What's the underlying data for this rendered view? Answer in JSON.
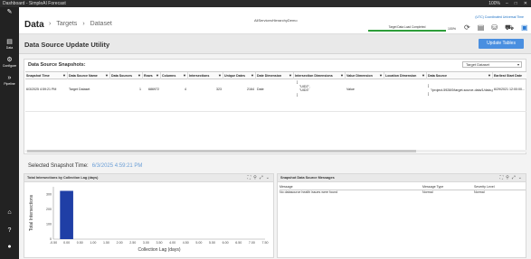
{
  "titlebar": {
    "title": "Dashboard - SimpleAI Forecast",
    "zoom": "100%"
  },
  "rail": [
    {
      "icon": "✎",
      "label": ""
    },
    {
      "icon": "▤",
      "label": "Data"
    },
    {
      "icon": "⚙",
      "label": "Configure"
    },
    {
      "icon": "»",
      "label": "Pipeline"
    },
    {
      "icon": "⌂",
      "label": ""
    },
    {
      "icon": "?",
      "label": ""
    },
    {
      "icon": "●",
      "label": ""
    }
  ],
  "header": {
    "title": "Data",
    "crumbs": [
      "Targets",
      "Dataset"
    ],
    "org": "AllServicesHierarchyDemo",
    "sysinfo": "(UTC) Coordinated Universal Time",
    "status_label": "Target Data Load Completed",
    "status_pct": "100%",
    "status_value": 100
  },
  "page": {
    "title": "Data Source Update Utility",
    "update_button": "Update Tables"
  },
  "snapshots": {
    "title": "Data Source Snapshots:",
    "dropdown": "Target Dataset",
    "columns": [
      "Snapshot Time",
      "Data Source Name",
      "Data Sources",
      "Rows",
      "Columns",
      "Intersections",
      "Unique Dates",
      "Date Dimension",
      "Intersection Dimensions",
      "Value Dimension",
      "Location Dimension",
      "Data Source",
      "Earliest Start Date"
    ],
    "row": {
      "snapshot_time": "6/3/2025 4:59:21 PM",
      "name": "Target Dataset",
      "sources": "1",
      "rows": "686972",
      "columns": "4",
      "intersections": "323",
      "unique_dates": "2164",
      "date_dim": "Date",
      "inter_dims": [
        "[",
        "\"UID2\",",
        "\"UID3\"",
        "]"
      ],
      "value_dim": "Value",
      "location_dim": "",
      "data_source": [
        "[",
        "\"/project-5928/0/target-source-data/1/data.parquet\"",
        "]"
      ],
      "earliest": "6/29/2021 12:00:00..."
    }
  },
  "selected": {
    "label": "Selected Snapshot Time:",
    "value": "6/3/2025 4:59:21 PM"
  },
  "intersections_panel": {
    "title": "Total Intersections by Collection Lag (days)",
    "icons": [
      "⛶",
      "⚲",
      "⤢",
      "⌄"
    ]
  },
  "messages_panel": {
    "title": "Snapshot Data Source Messages",
    "icons": [
      "⛶",
      "⚲",
      "⤢",
      "⌄"
    ],
    "headers": [
      "Message",
      "Message Type",
      "Severity Level"
    ],
    "rows": [
      [
        "No datasource health issues were found",
        "Normal",
        "Normal"
      ]
    ]
  },
  "chart_data": {
    "type": "bar",
    "xlabel": "Collection Lag (days)",
    "ylabel": "Total Intersections",
    "x": [
      0.0
    ],
    "values": [
      323
    ],
    "xticks": [
      "-0.50",
      "0.00",
      "0.50",
      "1.00",
      "1.50",
      "2.00",
      "2.50",
      "3.00",
      "3.50",
      "4.00",
      "4.50",
      "5.00",
      "5.50",
      "6.00",
      "6.50",
      "7.00",
      "7.50"
    ],
    "yticks": [
      "0",
      "100",
      "200",
      "300"
    ],
    "xlim": [
      -0.5,
      7.5
    ],
    "ylim": [
      0,
      350
    ],
    "grid": false,
    "bar_color": "#1f3fa6"
  }
}
